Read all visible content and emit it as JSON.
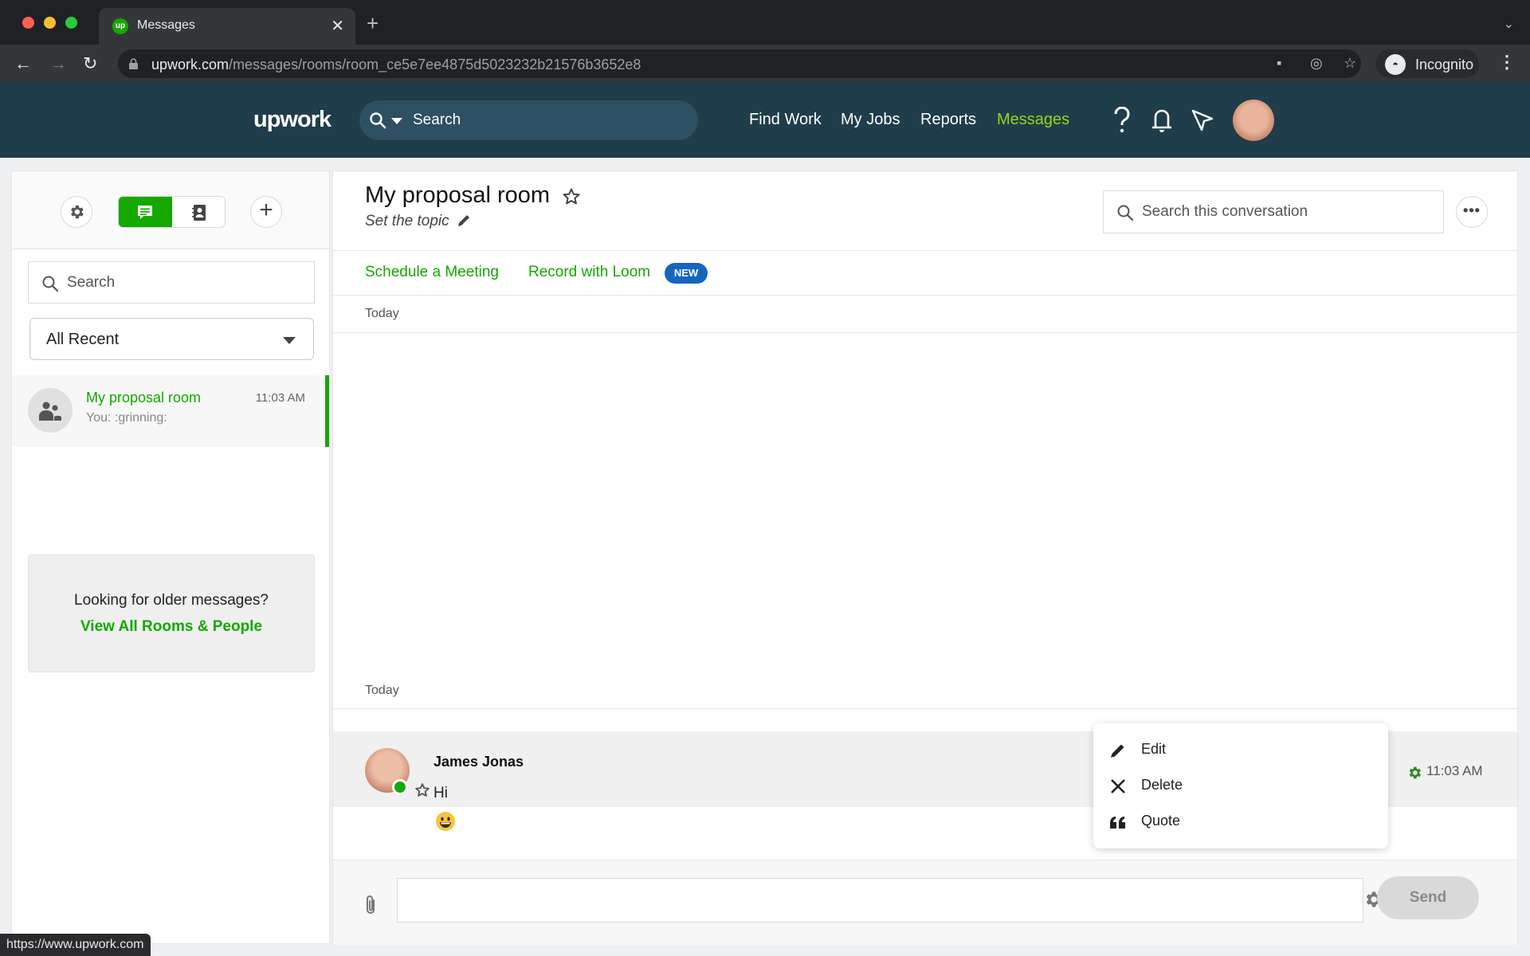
{
  "browser": {
    "tab_title": "Messages",
    "tab_favicon": "up",
    "url_domain": "upwork.com",
    "url_path": "/messages/rooms/room_ce5e7ee4875d5023232b21576b3652e8",
    "profile_label": "Incognito",
    "status_url": "https://www.upwork.com"
  },
  "header": {
    "logo": "upwork",
    "search_placeholder": "Search",
    "nav": [
      {
        "label": "Find Work",
        "active": false
      },
      {
        "label": "My Jobs",
        "active": false
      },
      {
        "label": "Reports",
        "active": false
      },
      {
        "label": "Messages",
        "active": true
      }
    ],
    "icons": [
      "help-icon",
      "bell-icon",
      "send-icon"
    ],
    "accent_color": "#8fd81a"
  },
  "sidebar": {
    "search_placeholder": "Search",
    "filter_selected": "All Recent",
    "rooms": [
      {
        "name": "My proposal room",
        "time": "11:03 AM",
        "preview": "You: :grinning:",
        "active": true
      }
    ],
    "older_prompt": "Looking for older messages?",
    "older_link": "View All Rooms & People"
  },
  "room": {
    "title": "My proposal room",
    "topic_placeholder": "Set the topic",
    "search_placeholder": "Search this conversation",
    "actions": [
      {
        "label": "Schedule a Meeting"
      },
      {
        "label": "Record with Loom",
        "badge": "NEW"
      }
    ],
    "day_labels": [
      "Today",
      "Today"
    ],
    "messages": [
      {
        "sender": "James Jonas",
        "text": "Hi",
        "time": "11:03 AM",
        "online": true,
        "followup_emoji": "😀"
      }
    ],
    "context_menu": [
      {
        "icon": "pencil-icon",
        "label": "Edit"
      },
      {
        "icon": "close-icon",
        "label": "Delete"
      },
      {
        "icon": "quote-icon",
        "label": "Quote"
      }
    ],
    "composer": {
      "value": "",
      "send_label": "Send"
    }
  },
  "colors": {
    "brand_green": "#14a800",
    "header_bg": "#1f3d4a",
    "badge_blue": "#1565c0"
  }
}
